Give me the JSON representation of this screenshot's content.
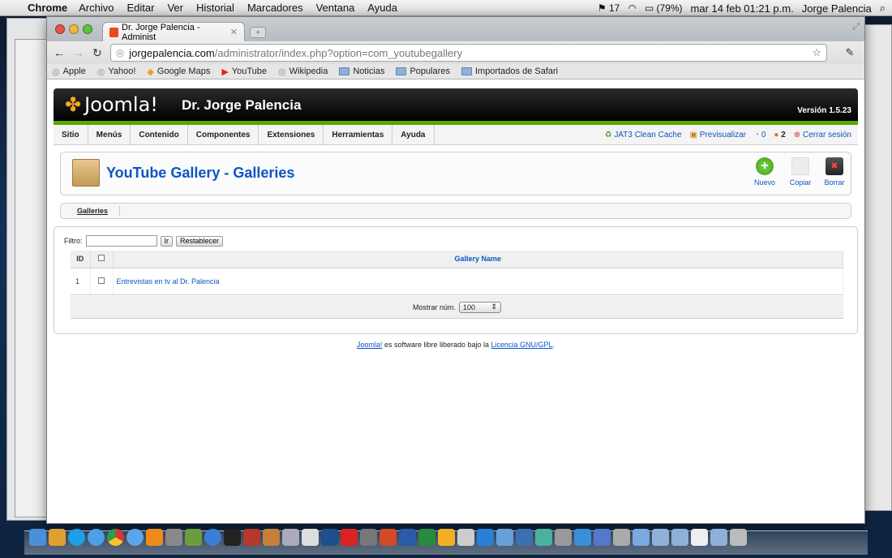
{
  "os_menubar": {
    "app": "Chrome",
    "menus": [
      "Archivo",
      "Editar",
      "Ver",
      "Historial",
      "Marcadores",
      "Ventana",
      "Ayuda"
    ],
    "tray_count": "17",
    "battery": "(79%)",
    "datetime": "mar 14 feb  01:21 p.m.",
    "user": "Jorge Palencia"
  },
  "browser": {
    "tab_title": "Dr. Jorge Palencia - Administ",
    "url_host": "jorgepalencia.com",
    "url_path": "/administrator/index.php?option=com_youtubegallery",
    "bookmarks": [
      "Apple",
      "Yahoo!",
      "Google Maps",
      "YouTube",
      "Wikipedia",
      "Noticias",
      "Populares",
      "Importados de Safari"
    ]
  },
  "joomla": {
    "logo_text": "Joomla!",
    "site_name": "Dr. Jorge Palencia",
    "version": "Versión 1.5.23",
    "menu": [
      "Sitio",
      "Menús",
      "Contenido",
      "Componentes",
      "Extensiones",
      "Herramientas",
      "Ayuda"
    ],
    "status": {
      "cache": "JAT3 Clean Cache",
      "preview": "Previsualizar",
      "messages": "0",
      "users": "2",
      "logout": "Cerrar sesión"
    },
    "page_title": "YouTube Gallery - Galleries",
    "toolbar": {
      "new": "Nuevo",
      "copy": "Copiar",
      "delete": "Borrar"
    },
    "submenu": "Galleries",
    "filter": {
      "label": "Filtro:",
      "go": "Ir",
      "reset": "Restablecer",
      "value": ""
    },
    "table": {
      "headers": {
        "id": "ID",
        "name": "Gallery Name"
      },
      "rows": [
        {
          "id": "1",
          "name": "Entrevistas en tv al Dr. Palencia"
        }
      ]
    },
    "limit": {
      "label": "Mostrar núm.",
      "value": "100"
    },
    "footer": {
      "joomla": "Joomla!",
      "text": " es software libre liberado bajo la ",
      "license": "Licencia GNU/GPL",
      "end": "."
    }
  },
  "colors": {
    "joomla_link": "#0b55c4",
    "joomla_green": "#5ca500"
  }
}
